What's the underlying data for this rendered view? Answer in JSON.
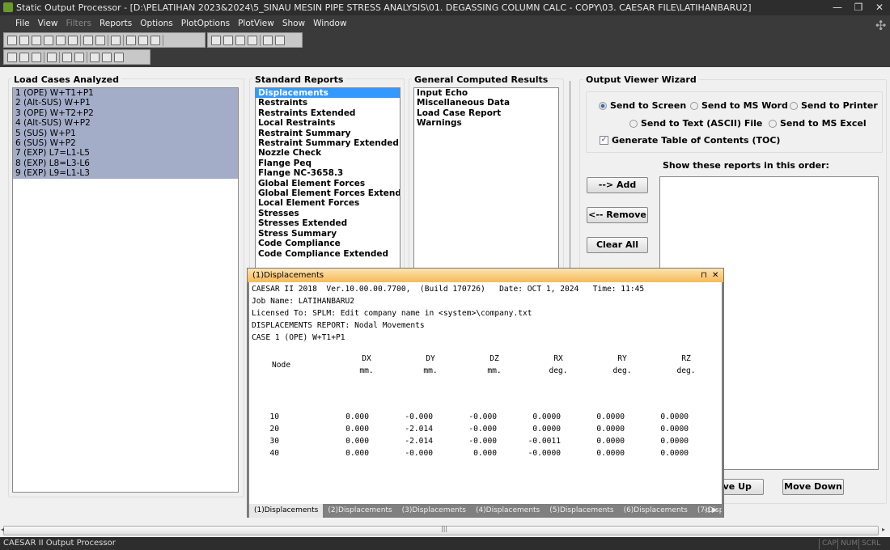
{
  "window": {
    "title": "Static Output Processor - [D:\\PELATIHAN 2023&2024\\5_SINAU MESIN PIPE STRESS ANALYSIS\\01. DEGASSING COLUMN CALC - COPY\\03. CAESAR FILE\\LATIHANBARU2]",
    "minimize": "—",
    "maximize": "❐",
    "close": "✕"
  },
  "menu": [
    {
      "label": "File"
    },
    {
      "label": "View"
    },
    {
      "label": "Filters",
      "disabled": true
    },
    {
      "label": "Reports"
    },
    {
      "label": "Options"
    },
    {
      "label": "PlotOptions"
    },
    {
      "label": "PlotView"
    },
    {
      "label": "Show"
    },
    {
      "label": "Window"
    }
  ],
  "load_cases": {
    "title": "Load Cases Analyzed",
    "items": [
      "1 (OPE) W+T1+P1",
      "2 (Alt-SUS) W+P1",
      "3 (OPE) W+T2+P2",
      "4 (Alt-SUS) W+P2",
      "5 (SUS) W+P1",
      "6 (SUS) W+P2",
      "7 (EXP) L7=L1-L5",
      "8 (EXP) L8=L3-L6",
      "9 (EXP) L9=L1-L3"
    ]
  },
  "standard_reports": {
    "title": "Standard Reports",
    "selected": "Displacements",
    "items": [
      "Displacements",
      "Restraints",
      "Restraints Extended",
      "Local Restraints",
      "Restraint Summary",
      "Restraint Summary Extended",
      "Nozzle Check",
      "Flange Peq",
      "Flange NC-3658.3",
      "Global Element Forces",
      "Global Element Forces Extended",
      "Local Element Forces",
      "Stresses",
      "Stresses Extended",
      "Stress Summary",
      "Code Compliance",
      "Code Compliance Extended"
    ]
  },
  "general_results": {
    "title": "General Computed Results",
    "items": [
      "Input Echo",
      "Miscellaneous Data",
      "Load Case Report",
      "Warnings"
    ]
  },
  "wizard": {
    "title": "Output Viewer Wizard",
    "radios": [
      {
        "label": "Send to Screen",
        "checked": true
      },
      {
        "label": "Send to MS Word",
        "checked": false
      },
      {
        "label": "Send to Printer",
        "checked": false
      },
      {
        "label": "Send to Text (ASCII) File",
        "checked": false
      },
      {
        "label": "Send to MS Excel",
        "checked": false
      }
    ],
    "toc_label": "Generate Table of Contents (TOC)",
    "toc_checked": true,
    "order_label": "Show these reports in this order:",
    "add": "--> Add",
    "remove": "<-- Remove",
    "clear": "Clear All",
    "move_up": "Move Up",
    "move_down": "Move Down"
  },
  "report": {
    "title": "(1)Displacements",
    "pin": "⊓",
    "close": "✕",
    "header_lines": [
      "CAESAR II 2018  Ver.10.00.00.7700,  (Build 170726)   Date: OCT 1, 2024   Time: 11:45",
      "Job Name: LATIHANBARU2",
      "Licensed To: SPLM: Edit company name in <system>\\company.txt",
      "DISPLACEMENTS REPORT: Nodal Movements",
      "CASE 1 (OPE) W+T1+P1"
    ],
    "columns": [
      {
        "name": "Node",
        "unit": ""
      },
      {
        "name": "DX",
        "unit": "mm."
      },
      {
        "name": "DY",
        "unit": "mm."
      },
      {
        "name": "DZ",
        "unit": "mm."
      },
      {
        "name": "RX",
        "unit": "deg."
      },
      {
        "name": "RY",
        "unit": "deg."
      },
      {
        "name": "RZ",
        "unit": "deg."
      }
    ],
    "rows": [
      [
        "10",
        "0.000",
        "-0.000",
        "-0.000",
        "0.0000",
        "0.0000",
        "0.0000"
      ],
      [
        "20",
        "0.000",
        "-2.014",
        "-0.000",
        "0.0000",
        "0.0000",
        "0.0000"
      ],
      [
        "30",
        "0.000",
        "-2.014",
        "-0.000",
        "-0.0011",
        "0.0000",
        "0.0000"
      ],
      [
        "40",
        "0.000",
        "-0.000",
        "0.000",
        "-0.0000",
        "0.0000",
        "0.0000"
      ]
    ],
    "tabs": [
      "(1)Displacements",
      "(2)Displacements",
      "(3)Displacements",
      "(4)Displacements",
      "(5)Displacements",
      "(6)Displacements",
      "(7)Displacements",
      "(8)Dis"
    ],
    "active_tab": 0
  },
  "status": {
    "text": "CAESAR II Output Processor",
    "indicators": [
      "CAP",
      "NUM",
      "SCRL"
    ]
  }
}
